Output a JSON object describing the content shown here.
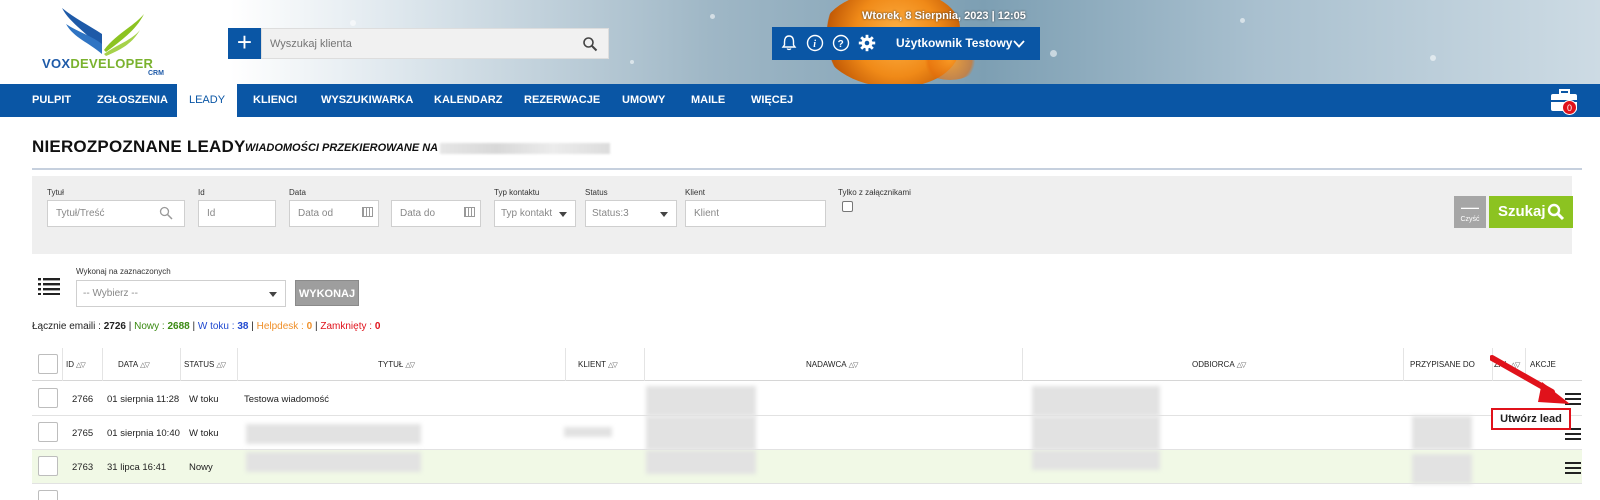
{
  "header": {
    "logo_main_a": "VOX",
    "logo_main_b": "DEVELOPER",
    "logo_sub": "CRM",
    "search_placeholder": "Wyszukaj klienta",
    "add_label": "+",
    "date": "Wtorek, 8 Sierpnia, 2023 | 12:05",
    "user_name": "Użytkownik Testowy",
    "icons": [
      "bell-icon",
      "info-icon",
      "help-icon",
      "gear-icon",
      "chevron-down-icon"
    ]
  },
  "nav": {
    "items": [
      "PULPIT",
      "ZGŁOSZENIA",
      "LEADY",
      "KLIENCI",
      "WYSZUKIWARKA",
      "KALENDARZ",
      "REZERWACJE",
      "UMOWY",
      "MAILE",
      "WIĘCEJ"
    ],
    "active": "LEADY",
    "toolbox_badge": "0"
  },
  "page": {
    "title": "NIEROZPOZNANE LEADY",
    "subtitle": "WIADOMOŚCI PRZEKIEROWANE NA"
  },
  "filters": {
    "title_label": "Tytuł",
    "title_placeholder": "Tytuł/Treść",
    "id_label": "Id",
    "id_placeholder": "Id",
    "date_label": "Data",
    "date_from_placeholder": "Data od",
    "date_to_placeholder": "Data do",
    "contact_type_label": "Typ kontaktu",
    "contact_type_value": "Typ kontakt",
    "status_label": "Status",
    "status_value": "Status:3",
    "client_label": "Klient",
    "client_placeholder": "Klient",
    "attachments_label": "Tylko z załącznikami",
    "clear_label": "Czyść",
    "search_label": "Szukaj"
  },
  "bulk": {
    "label": "Wykonaj na zaznaczonych",
    "select_value": "-- Wybierz --",
    "execute_label": "WYKONAJ"
  },
  "stats": {
    "total_label": "Łącznie emaili : ",
    "total_value": "2726",
    "new_label": "Nowy : ",
    "new_value": "2688",
    "in_progress_label": "W toku : ",
    "in_progress_value": "38",
    "helpdesk_label": "Helpdesk : ",
    "helpdesk_value": "0",
    "closed_label": "Zamknięty : ",
    "closed_value": "0",
    "sep": " | "
  },
  "table": {
    "columns": {
      "id": "ID",
      "date": "DATA",
      "status": "STATUS",
      "title": "TYTUŁ",
      "client": "KLIENT",
      "sender": "NADAWCA",
      "recipient": "ODBIORCA",
      "assigned": "PRZYPISANE DO",
      "attachment": "ZAŁ",
      "actions": "AKCJE"
    },
    "rows": [
      {
        "id": "2766",
        "date": "01 sierpnia 11:28",
        "status": "W toku",
        "title": "Testowa wiadomość"
      },
      {
        "id": "2765",
        "date": "01 sierpnia 10:40",
        "status": "W toku",
        "title": ""
      },
      {
        "id": "2763",
        "date": "31 lipca 16:41",
        "status": "Nowy",
        "title": ""
      }
    ],
    "create_lead_label": "Utwórz lead"
  },
  "colors": {
    "brand_blue": "#0a56a5",
    "accent_green": "#8cc321",
    "highlight_red": "#e0121b",
    "row_new_bg": "#f1f9e6"
  }
}
